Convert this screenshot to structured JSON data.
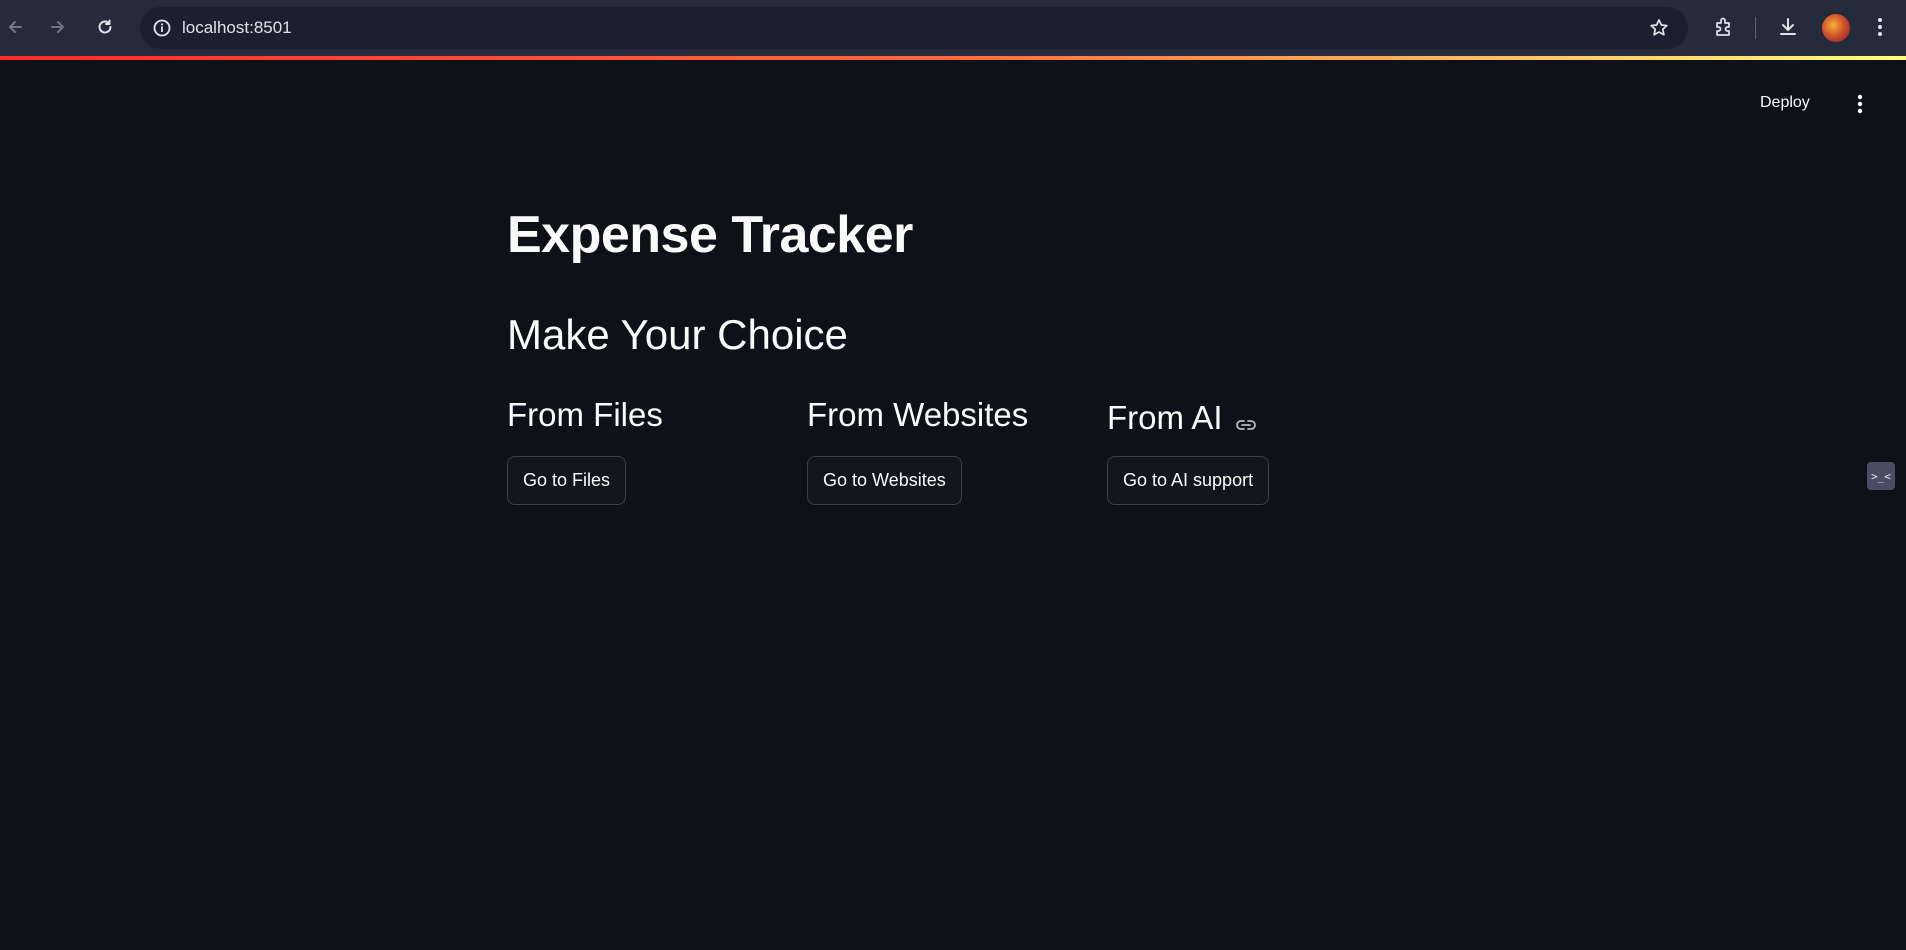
{
  "browser": {
    "url": "localhost:8501",
    "icons": [
      "back-arrow-icon",
      "forward-arrow-icon",
      "reload-icon",
      "site-info-icon",
      "bookmark-star-icon",
      "extensions-icon",
      "download-icon",
      "profile-avatar",
      "kebab-menu-icon"
    ],
    "loading_bar_colors": [
      "#ff2b2b",
      "#ff6a3d",
      "#fffd80"
    ]
  },
  "app": {
    "deploy_label": "Deploy",
    "title": "Expense Tracker",
    "subtitle": "Make Your Choice",
    "columns": [
      {
        "heading": "From Files",
        "button_label": "Go to Files"
      },
      {
        "heading": "From Websites",
        "button_label": "Go to Websites"
      },
      {
        "heading": "From AI",
        "button_label": "Go to AI support",
        "heading_icon": "link-icon"
      }
    ],
    "side_widget_glyph": ">_<"
  },
  "colors": {
    "background": "#0e1117",
    "text": "#fafafa",
    "button_border": "#3b3f4a",
    "browser_chrome": "#252b3a"
  }
}
